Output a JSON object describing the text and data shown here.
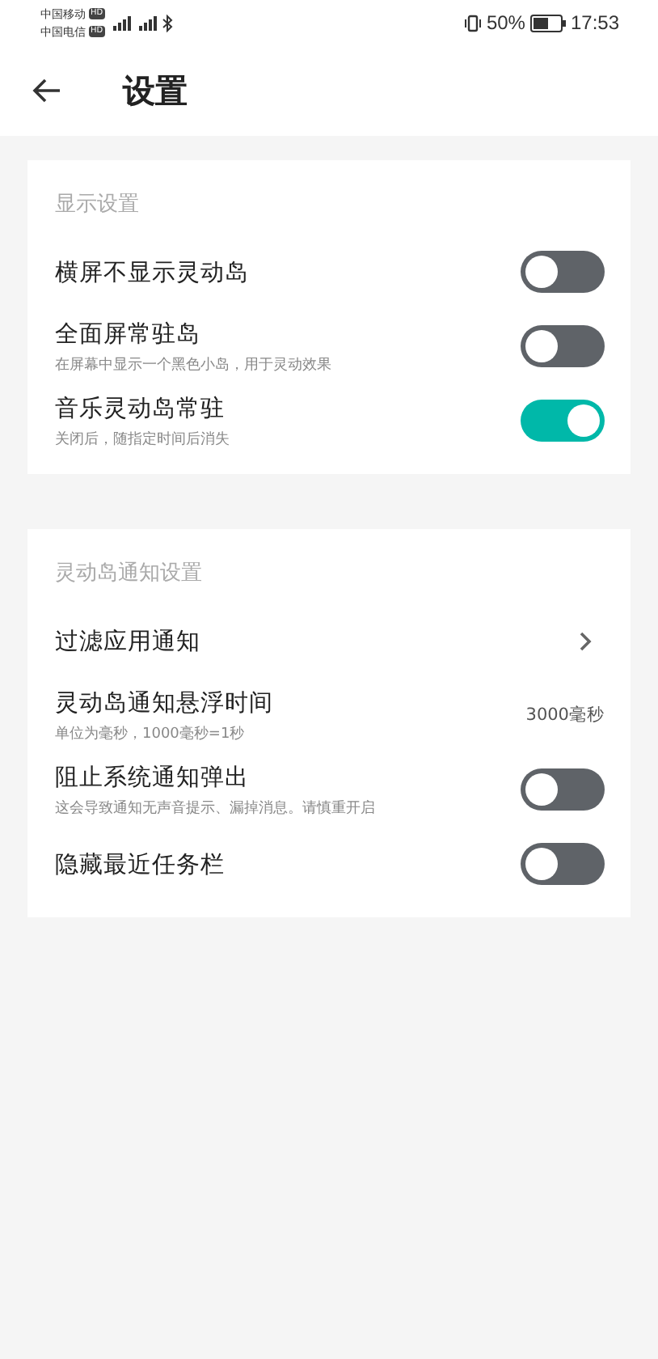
{
  "status_bar": {
    "carriers": [
      {
        "name": "中国移动",
        "badge": "HD"
      },
      {
        "name": "中国电信",
        "badge": "HD"
      }
    ],
    "battery": "50%",
    "time": "17:53"
  },
  "header": {
    "title": "设置"
  },
  "sections": [
    {
      "title": "显示设置",
      "items": [
        {
          "kind": "toggle",
          "label": "横屏不显示灵动岛",
          "on": false
        },
        {
          "kind": "toggle",
          "label": "全面屏常驻岛",
          "subtitle": "在屏幕中显示一个黑色小岛，用于灵动效果",
          "on": false
        },
        {
          "kind": "toggle",
          "label": "音乐灵动岛常驻",
          "subtitle": "关闭后，随指定时间后消失",
          "on": true
        }
      ]
    },
    {
      "title": "灵动岛通知设置",
      "items": [
        {
          "kind": "link",
          "label": "过滤应用通知"
        },
        {
          "kind": "value",
          "label": "灵动岛通知悬浮时间",
          "subtitle": "单位为毫秒，1000毫秒=1秒",
          "value": "3000毫秒"
        },
        {
          "kind": "toggle",
          "label": "阻止系统通知弹出",
          "subtitle": "这会导致通知无声音提示、漏掉消息。请慎重开启",
          "on": false
        },
        {
          "kind": "toggle",
          "label": "隐藏最近任务栏",
          "on": false
        }
      ]
    }
  ]
}
